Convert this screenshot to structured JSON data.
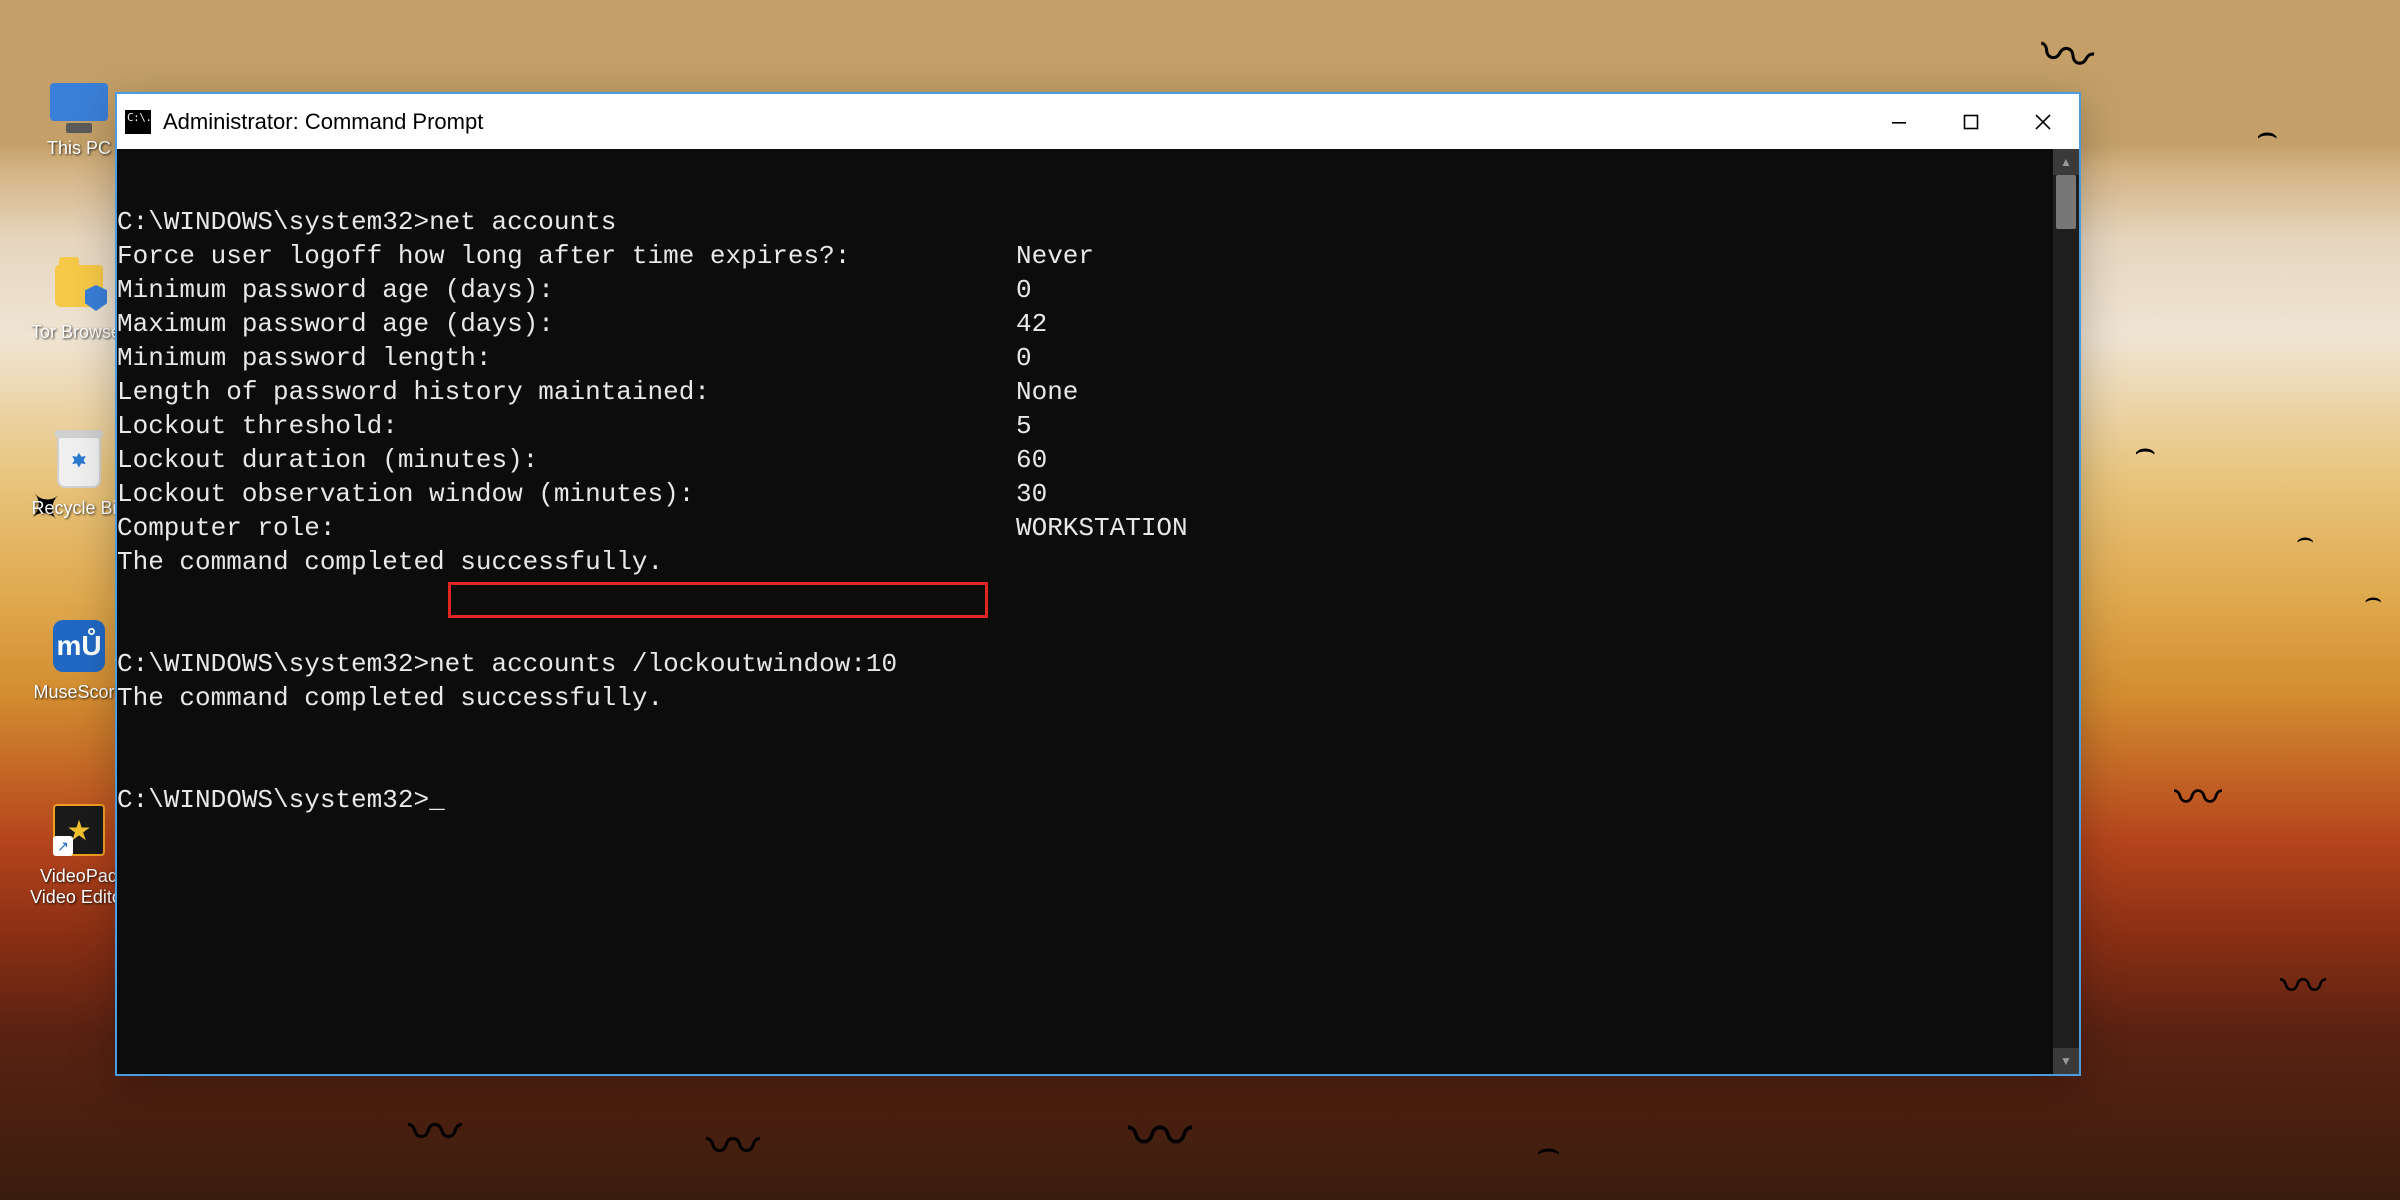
{
  "desktop": {
    "icons": [
      {
        "label": "This PC"
      },
      {
        "label": "Tor Browser"
      },
      {
        "label": "Recycle Bin"
      },
      {
        "label": "MuseScore"
      },
      {
        "label": "VideoPad\nVideo Editor"
      }
    ]
  },
  "window": {
    "title": "Administrator: Command Prompt",
    "icon_text": "C:\\."
  },
  "terminal": {
    "prompt": "C:\\WINDOWS\\system32>",
    "cmd1": "net accounts",
    "output_rows": [
      {
        "label": "Force user logoff how long after time expires?:",
        "value": "Never"
      },
      {
        "label": "Minimum password age (days):",
        "value": "0"
      },
      {
        "label": "Maximum password age (days):",
        "value": "42"
      },
      {
        "label": "Minimum password length:",
        "value": "0"
      },
      {
        "label": "Length of password history maintained:",
        "value": "None"
      },
      {
        "label": "Lockout threshold:",
        "value": "5"
      },
      {
        "label": "Lockout duration (minutes):",
        "value": "60"
      },
      {
        "label": "Lockout observation window (minutes):",
        "value": "30"
      },
      {
        "label": "Computer role:",
        "value": "WORKSTATION"
      }
    ],
    "success_msg": "The command completed successfully.",
    "cmd2": "net accounts /lockoutwindow:10",
    "cursor": "_"
  }
}
